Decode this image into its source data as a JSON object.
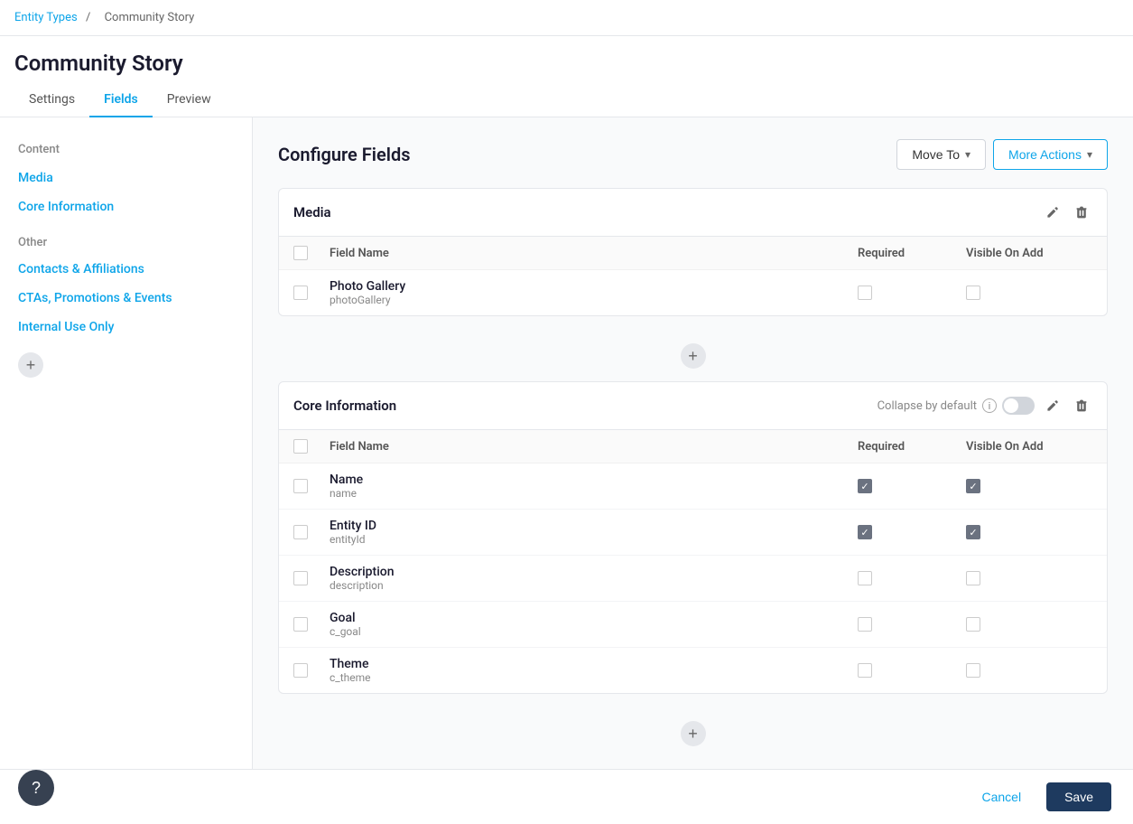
{
  "breadcrumb": {
    "link_label": "Entity Types",
    "separator": "/",
    "current": "Community Story"
  },
  "page": {
    "title": "Community Story"
  },
  "tabs": [
    {
      "id": "settings",
      "label": "Settings"
    },
    {
      "id": "fields",
      "label": "Fields",
      "active": true
    },
    {
      "id": "preview",
      "label": "Preview"
    }
  ],
  "sidebar": {
    "content_label": "Content",
    "items_content": [
      {
        "id": "media",
        "label": "Media"
      },
      {
        "id": "core-information",
        "label": "Core Information"
      }
    ],
    "other_label": "Other",
    "items_other": [
      {
        "id": "contacts",
        "label": "Contacts & Affiliations"
      },
      {
        "id": "ctas",
        "label": "CTAs, Promotions & Events"
      },
      {
        "id": "internal",
        "label": "Internal Use Only"
      }
    ]
  },
  "configure": {
    "title": "Configure Fields",
    "move_to_label": "Move To",
    "more_actions_label": "More Actions"
  },
  "sections": [
    {
      "id": "media",
      "title": "Media",
      "has_collapse": false,
      "fields": [
        {
          "name": "Photo Gallery",
          "key": "photoGallery",
          "required": false,
          "visible_on_add": false
        }
      ]
    },
    {
      "id": "core-information",
      "title": "Core Information",
      "has_collapse": true,
      "collapse_label": "Collapse by default",
      "collapse_on": false,
      "fields": [
        {
          "name": "Name",
          "key": "name",
          "required": true,
          "visible_on_add": true
        },
        {
          "name": "Entity ID",
          "key": "entityId",
          "required": true,
          "visible_on_add": true
        },
        {
          "name": "Description",
          "key": "description",
          "required": false,
          "visible_on_add": false
        },
        {
          "name": "Goal",
          "key": "c_goal",
          "required": false,
          "visible_on_add": false
        },
        {
          "name": "Theme",
          "key": "c_theme",
          "required": false,
          "visible_on_add": false
        }
      ]
    }
  ],
  "columns": {
    "field_name": "Field Name",
    "required": "Required",
    "visible_on_add": "Visible On Add"
  },
  "footer": {
    "cancel_label": "Cancel",
    "save_label": "Save"
  },
  "help": {
    "label": "?"
  }
}
